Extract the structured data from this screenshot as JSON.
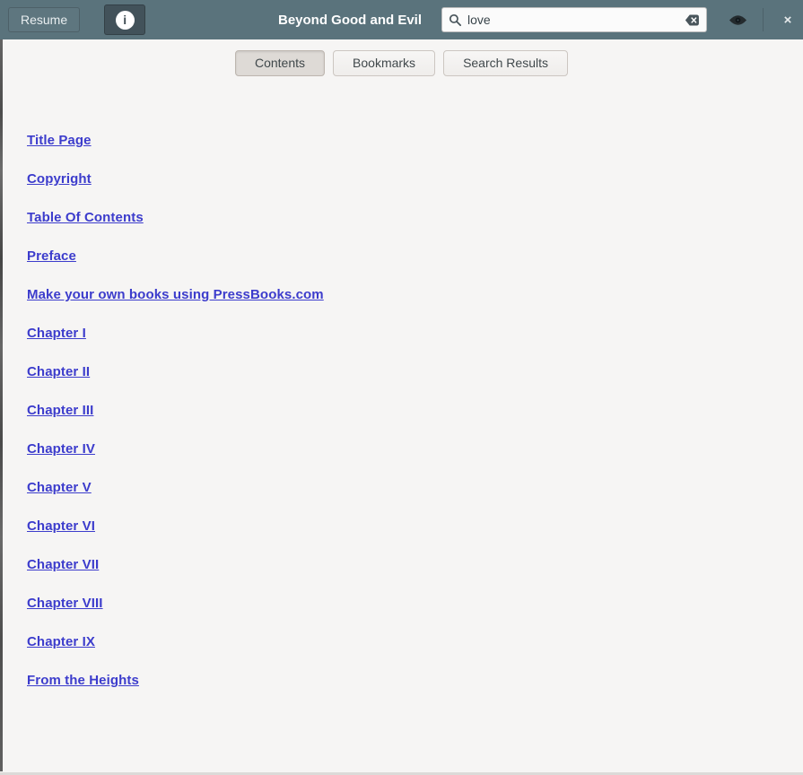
{
  "header": {
    "resume_label": "Resume",
    "title": "Beyond Good and Evil",
    "search": {
      "value": "love",
      "placeholder": ""
    },
    "icons": {
      "info_glyph": "i",
      "close_glyph": "×"
    },
    "colors": {
      "headerbar_bg": "#5a737c",
      "info_active_bg": "#42525a",
      "title_color": "#ffffff"
    }
  },
  "tabs": [
    {
      "label": "Contents",
      "active": true
    },
    {
      "label": "Bookmarks",
      "active": false
    },
    {
      "label": "Search Results",
      "active": false
    }
  ],
  "toc": {
    "link_color": "#3c3ccc",
    "items": [
      {
        "label": "Title Page"
      },
      {
        "label": "Copyright"
      },
      {
        "label": "Table Of Contents"
      },
      {
        "label": "Preface"
      },
      {
        "label": "Make your own books using PressBooks.com"
      },
      {
        "label": "Chapter I"
      },
      {
        "label": "Chapter II"
      },
      {
        "label": "Chapter III"
      },
      {
        "label": "Chapter IV"
      },
      {
        "label": "Chapter V"
      },
      {
        "label": "Chapter VI"
      },
      {
        "label": "Chapter VII"
      },
      {
        "label": "Chapter VIII"
      },
      {
        "label": "Chapter IX"
      },
      {
        "label": "From the Heights"
      }
    ]
  }
}
